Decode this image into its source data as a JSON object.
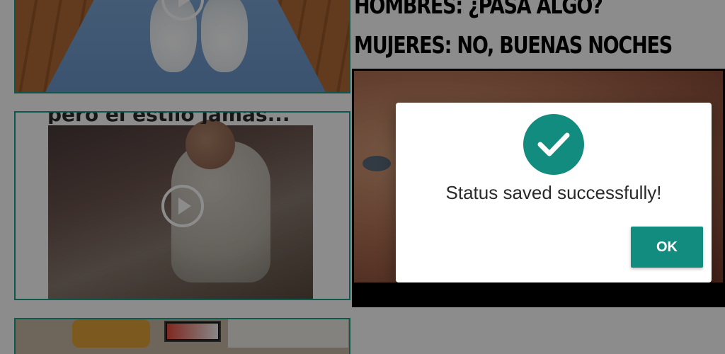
{
  "feed": {
    "cards": [
      {
        "type": "video",
        "icon": "play-icon"
      },
      {
        "type": "video",
        "caption": "pero el estilo jamás...",
        "icon": "play-icon"
      },
      {
        "type": "image"
      }
    ]
  },
  "preview": {
    "meme_line_1": "HOMBRES: ¿PASA ALGO?",
    "meme_line_2": "MUJERES: NO, BUENAS NOCHES"
  },
  "dialog": {
    "icon": "check-circle-icon",
    "message": "Status saved successfully!",
    "ok_label": "OK"
  },
  "colors": {
    "accent": "#128c7e",
    "card_border": "#1a9e8a",
    "scrim": "rgba(0,0,0,0.45)"
  }
}
